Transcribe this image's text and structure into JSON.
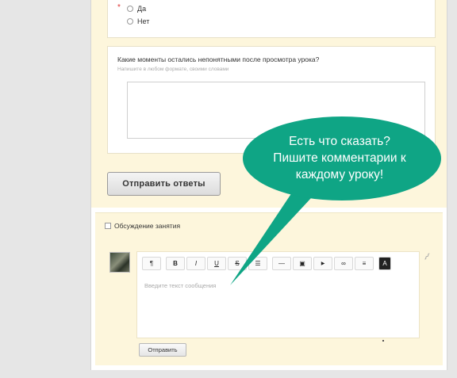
{
  "survey": {
    "options": [
      {
        "label": "Да"
      },
      {
        "label": "Нет"
      }
    ],
    "required_mark": "*",
    "question": {
      "title": "Какие моменты остались непонятными после просмотра урока?",
      "hint": "Напишите в любом формате, своими словами"
    },
    "submit_label": "Отправить ответы"
  },
  "discussion": {
    "title": "Обсуждение занятия",
    "toolbar": [
      {
        "icon": "paragraph-icon",
        "glyph": "¶"
      },
      {
        "icon": "bold-icon",
        "glyph": "B"
      },
      {
        "icon": "italic-icon",
        "glyph": "I"
      },
      {
        "icon": "underline-icon",
        "glyph": "U"
      },
      {
        "icon": "strikethrough-icon",
        "glyph": "S"
      },
      {
        "icon": "list-icon",
        "glyph": "☰"
      },
      {
        "icon": "horizontal-rule-icon",
        "glyph": "—"
      },
      {
        "icon": "image-icon",
        "glyph": "▣"
      },
      {
        "icon": "video-icon",
        "glyph": "▶"
      },
      {
        "icon": "link-icon",
        "glyph": "∞"
      },
      {
        "icon": "align-icon",
        "glyph": "≡"
      },
      {
        "icon": "font-icon",
        "glyph": "A"
      }
    ],
    "placeholder": "Введите текст сообщения",
    "send_label": "Отправить",
    "attach_icon": "paperclip-icon"
  },
  "callout": {
    "lines": [
      "Есть что сказать?",
      "Пишите комментарии к",
      "каждому уроку!"
    ],
    "color": "#0fa585"
  }
}
